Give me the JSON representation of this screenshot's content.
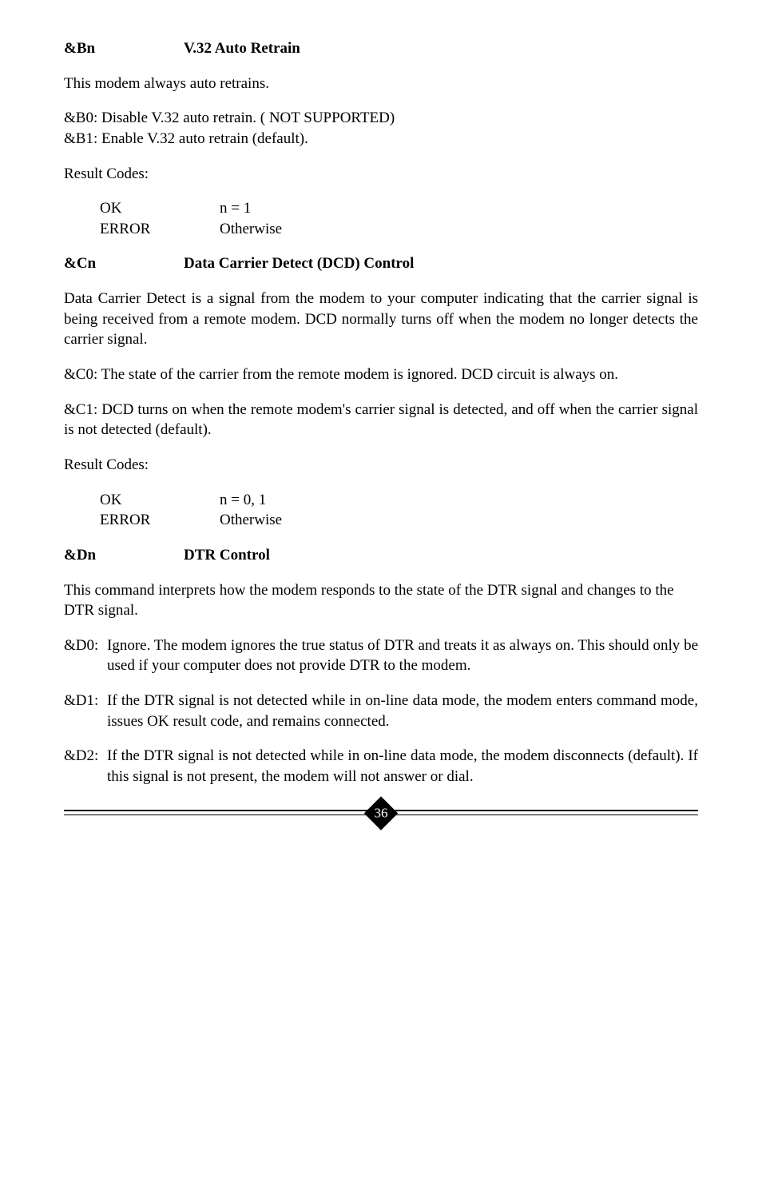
{
  "sections": [
    {
      "cmd": "&Bn",
      "title": "V.32 Auto Retrain",
      "intro": "This modem always auto retrains.",
      "opts": [
        "&B0: Disable V.32 auto retrain. ( NOT SUPPORTED)",
        "&B1: Enable V.32 auto retrain (default)."
      ],
      "result_label": "Result Codes:",
      "results": [
        {
          "label": "OK",
          "val": "n = 1"
        },
        {
          "label": "ERROR",
          "val": "Otherwise"
        }
      ]
    },
    {
      "cmd": "&Cn",
      "title": "Data Carrier Detect (DCD) Control",
      "paras": [
        "Data Carrier Detect is a signal from the modem to your computer indicating that the carrier signal is being received from a remote modem. DCD normally turns off when the modem no longer detects the carrier signal.",
        "&C0: The state of the carrier from the remote modem is ignored. DCD circuit is always on.",
        "&C1: DCD turns on when the remote modem's carrier signal is detected, and off when the carrier signal is not detected (default)."
      ],
      "result_label": "Result Codes:",
      "results": [
        {
          "label": "OK",
          "val": "n = 0, 1"
        },
        {
          "label": "ERROR",
          "val": "Otherwise"
        }
      ]
    },
    {
      "cmd": "&Dn",
      "title": "DTR Control",
      "intro": "This command interprets how the modem responds to the state of the DTR signal and changes to the DTR signal.",
      "hanging": [
        {
          "tag": "&D0:",
          "body": "Ignore.  The modem ignores the true status of DTR and treats it as always on. This should only be used if your computer does not provide DTR to the modem."
        },
        {
          "tag": "&D1:",
          "body": "If the DTR signal is not detected while in on-line data mode, the modem enters command mode, issues OK result code, and remains connected."
        },
        {
          "tag": "&D2:",
          "body": "If the DTR signal is not detected while in on-line data mode, the modem disconnects (default). If this signal is not present, the modem will not answer or dial."
        }
      ]
    }
  ],
  "page_number": "36"
}
